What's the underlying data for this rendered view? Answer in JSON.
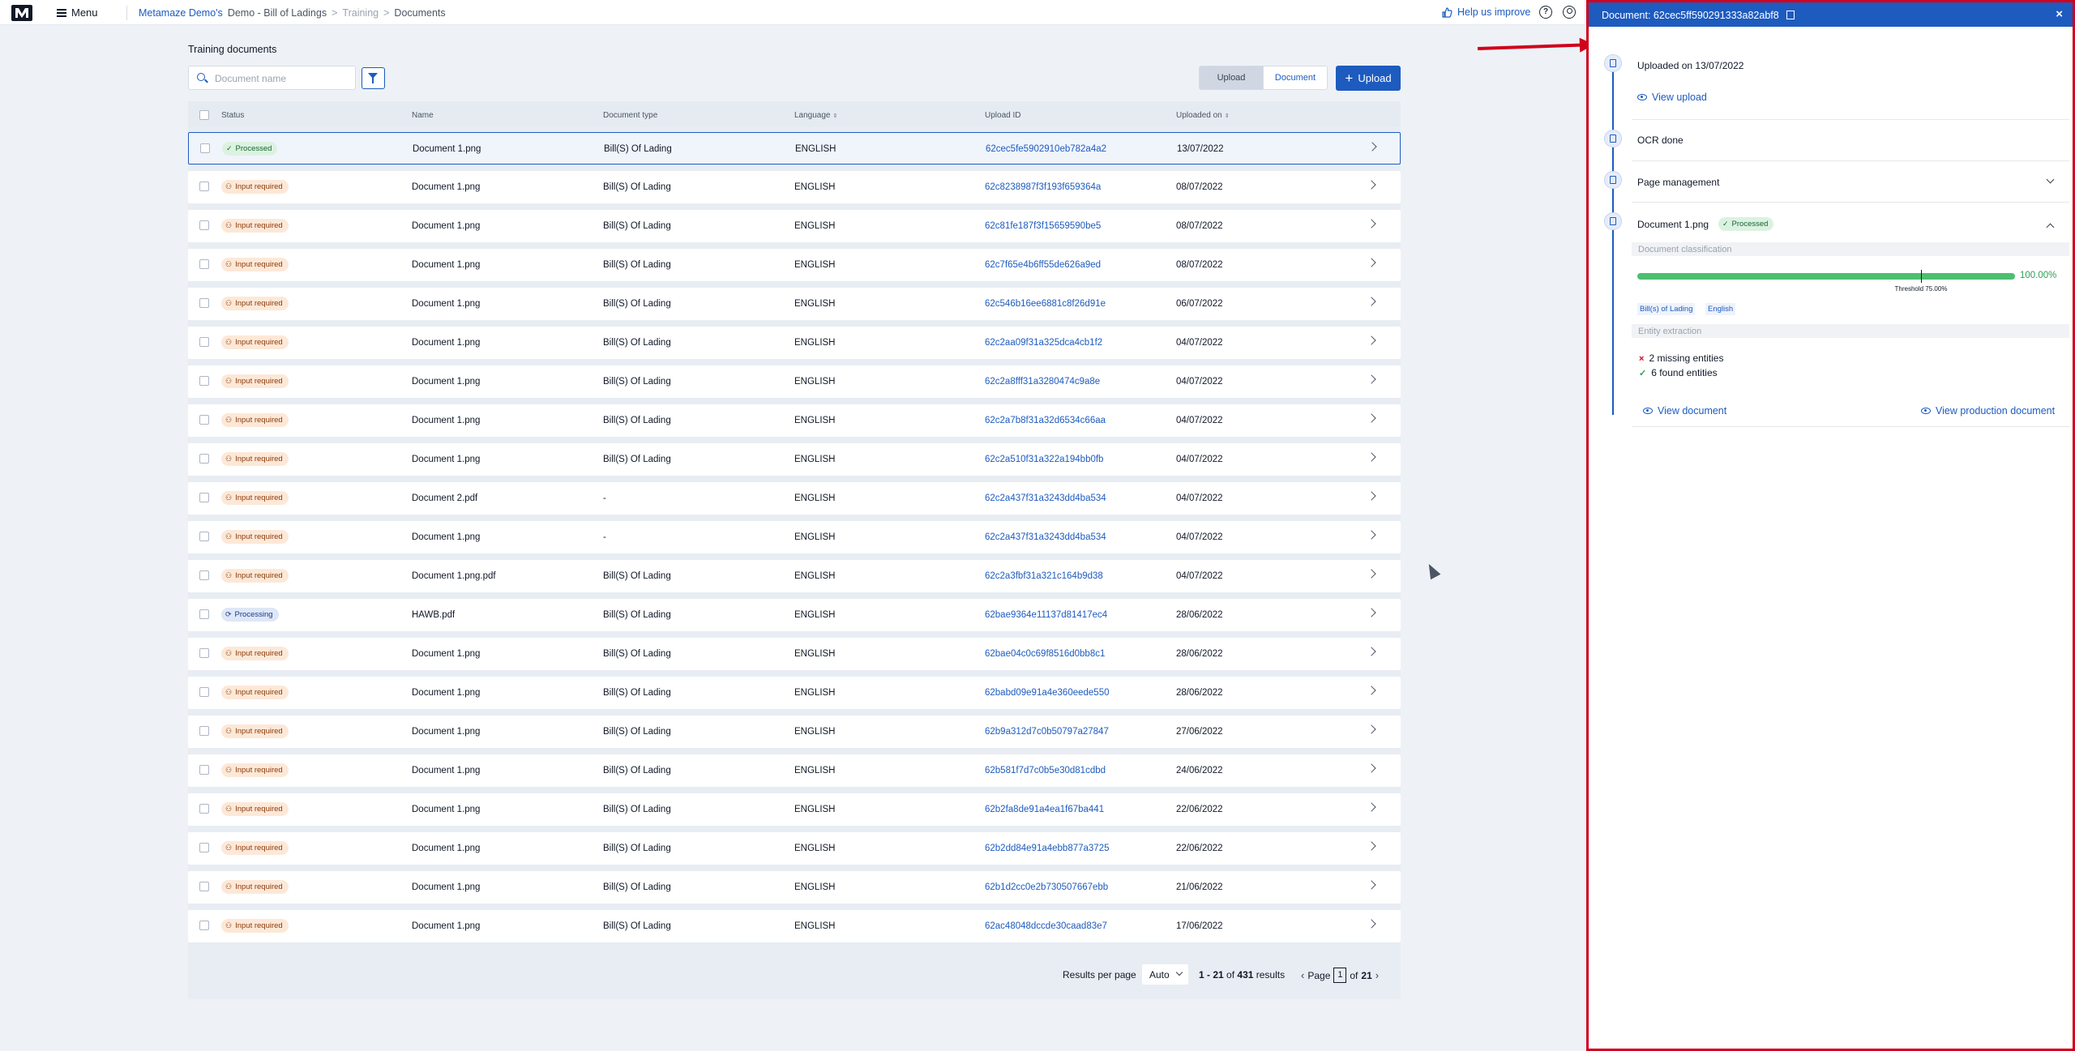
{
  "topbar": {
    "menu_label": "Menu",
    "breadcrumb": [
      "Metamaze Demo's",
      "Demo - Bill of Ladings",
      "Training",
      "Documents"
    ],
    "breadcrumb_sep": ">",
    "help_label": "Help us improve",
    "help_icon_glyph": "?"
  },
  "main": {
    "section_title": "Training documents",
    "search_placeholder": "Document name",
    "toggle": {
      "upload": "Upload",
      "document": "Document",
      "active": "upload"
    },
    "upload_button": "Upload",
    "upload_button_plus": "+",
    "columns": [
      "Status",
      "Name",
      "Document type",
      "Language",
      "Upload ID",
      "Uploaded on"
    ],
    "sortable_columns": [
      "Language",
      "Uploaded on"
    ],
    "sort_glyph": "⇕",
    "rows": [
      {
        "status": "Processed",
        "name": "Document 1.png",
        "type": "Bill(S) Of Lading",
        "language": "ENGLISH",
        "upload_id": "62cec5fe5902910eb782a4a2",
        "uploaded_on": "13/07/2022",
        "selected": true
      },
      {
        "status": "Input required",
        "name": "Document 1.png",
        "type": "Bill(S) Of Lading",
        "language": "ENGLISH",
        "upload_id": "62c8238987f3f193f659364a",
        "uploaded_on": "08/07/2022"
      },
      {
        "status": "Input required",
        "name": "Document 1.png",
        "type": "Bill(S) Of Lading",
        "language": "ENGLISH",
        "upload_id": "62c81fe187f3f15659590be5",
        "uploaded_on": "08/07/2022"
      },
      {
        "status": "Input required",
        "name": "Document 1.png",
        "type": "Bill(S) Of Lading",
        "language": "ENGLISH",
        "upload_id": "62c7f65e4b6ff55de626a9ed",
        "uploaded_on": "08/07/2022"
      },
      {
        "status": "Input required",
        "name": "Document 1.png",
        "type": "Bill(S) Of Lading",
        "language": "ENGLISH",
        "upload_id": "62c546b16ee6881c8f26d91e",
        "uploaded_on": "06/07/2022"
      },
      {
        "status": "Input required",
        "name": "Document 1.png",
        "type": "Bill(S) Of Lading",
        "language": "ENGLISH",
        "upload_id": "62c2aa09f31a325dca4cb1f2",
        "uploaded_on": "04/07/2022"
      },
      {
        "status": "Input required",
        "name": "Document 1.png",
        "type": "Bill(S) Of Lading",
        "language": "ENGLISH",
        "upload_id": "62c2a8fff31a3280474c9a8e",
        "uploaded_on": "04/07/2022"
      },
      {
        "status": "Input required",
        "name": "Document 1.png",
        "type": "Bill(S) Of Lading",
        "language": "ENGLISH",
        "upload_id": "62c2a7b8f31a32d6534c66aa",
        "uploaded_on": "04/07/2022"
      },
      {
        "status": "Input required",
        "name": "Document 1.png",
        "type": "Bill(S) Of Lading",
        "language": "ENGLISH",
        "upload_id": "62c2a510f31a322a194bb0fb",
        "uploaded_on": "04/07/2022"
      },
      {
        "status": "Input required",
        "name": "Document 2.pdf",
        "type": "-",
        "language": "ENGLISH",
        "upload_id": "62c2a437f31a3243dd4ba534",
        "uploaded_on": "04/07/2022"
      },
      {
        "status": "Input required",
        "name": "Document 1.png",
        "type": "-",
        "language": "ENGLISH",
        "upload_id": "62c2a437f31a3243dd4ba534",
        "uploaded_on": "04/07/2022"
      },
      {
        "status": "Input required",
        "name": "Document 1.png.pdf",
        "type": "Bill(S) Of Lading",
        "language": "ENGLISH",
        "upload_id": "62c2a3fbf31a321c164b9d38",
        "uploaded_on": "04/07/2022"
      },
      {
        "status": "Processing",
        "name": "HAWB.pdf",
        "type": "Bill(S) Of Lading",
        "language": "ENGLISH",
        "upload_id": "62bae9364e11137d81417ec4",
        "uploaded_on": "28/06/2022"
      },
      {
        "status": "Input required",
        "name": "Document 1.png",
        "type": "Bill(S) Of Lading",
        "language": "ENGLISH",
        "upload_id": "62bae04c0c69f8516d0bb8c1",
        "uploaded_on": "28/06/2022"
      },
      {
        "status": "Input required",
        "name": "Document 1.png",
        "type": "Bill(S) Of Lading",
        "language": "ENGLISH",
        "upload_id": "62babd09e91a4e360eede550",
        "uploaded_on": "28/06/2022"
      },
      {
        "status": "Input required",
        "name": "Document 1.png",
        "type": "Bill(S) Of Lading",
        "language": "ENGLISH",
        "upload_id": "62b9a312d7c0b50797a27847",
        "uploaded_on": "27/06/2022"
      },
      {
        "status": "Input required",
        "name": "Document 1.png",
        "type": "Bill(S) Of Lading",
        "language": "ENGLISH",
        "upload_id": "62b581f7d7c0b5e30d81cdbd",
        "uploaded_on": "24/06/2022"
      },
      {
        "status": "Input required",
        "name": "Document 1.png",
        "type": "Bill(S) Of Lading",
        "language": "ENGLISH",
        "upload_id": "62b2fa8de91a4ea1f67ba441",
        "uploaded_on": "22/06/2022"
      },
      {
        "status": "Input required",
        "name": "Document 1.png",
        "type": "Bill(S) Of Lading",
        "language": "ENGLISH",
        "upload_id": "62b2dd84e91a4ebb877a3725",
        "uploaded_on": "22/06/2022"
      },
      {
        "status": "Input required",
        "name": "Document 1.png",
        "type": "Bill(S) Of Lading",
        "language": "ENGLISH",
        "upload_id": "62b1d2cc0e2b730507667ebb",
        "uploaded_on": "21/06/2022"
      },
      {
        "status": "Input required",
        "name": "Document 1.png",
        "type": "Bill(S) Of Lading",
        "language": "ENGLISH",
        "upload_id": "62ac48048dccde30caad83e7",
        "uploaded_on": "17/06/2022"
      }
    ],
    "pager": {
      "results_per_page_label": "Results per page",
      "results_per_page_value": "Auto",
      "range": "1 - 21",
      "of_label": "of",
      "total": "431",
      "results_label": "results",
      "page_label": "Page",
      "page": "1",
      "page_of_label": "of",
      "total_pages": "21"
    }
  },
  "panel": {
    "title": "Document: 62cec5ff590291333a82abf8",
    "close_glyph": "×",
    "uploaded_text": "Uploaded on 13/07/2022",
    "view_upload": "View upload",
    "ocr_text": "OCR done",
    "page_management": "Page management",
    "document_name": "Document 1.png",
    "document_status": "Processed",
    "classification_label": "Document classification",
    "classification_pct_text": "100.00%",
    "classification_value": 1.0,
    "threshold_text": "Threshold 75.00%",
    "threshold_value": 0.75,
    "chips": [
      "Bill(s) of Lading",
      "English"
    ],
    "entity_label": "Entity extraction",
    "missing_entities": "2 missing entities",
    "found_entities": "6 found entities",
    "view_document": "View document",
    "view_production_document": "View production document"
  },
  "colors": {
    "accent": "#1d5bbf",
    "annotation_red": "#d0021b",
    "success": "#4cc070",
    "warning_bg": "#fde8d7"
  }
}
